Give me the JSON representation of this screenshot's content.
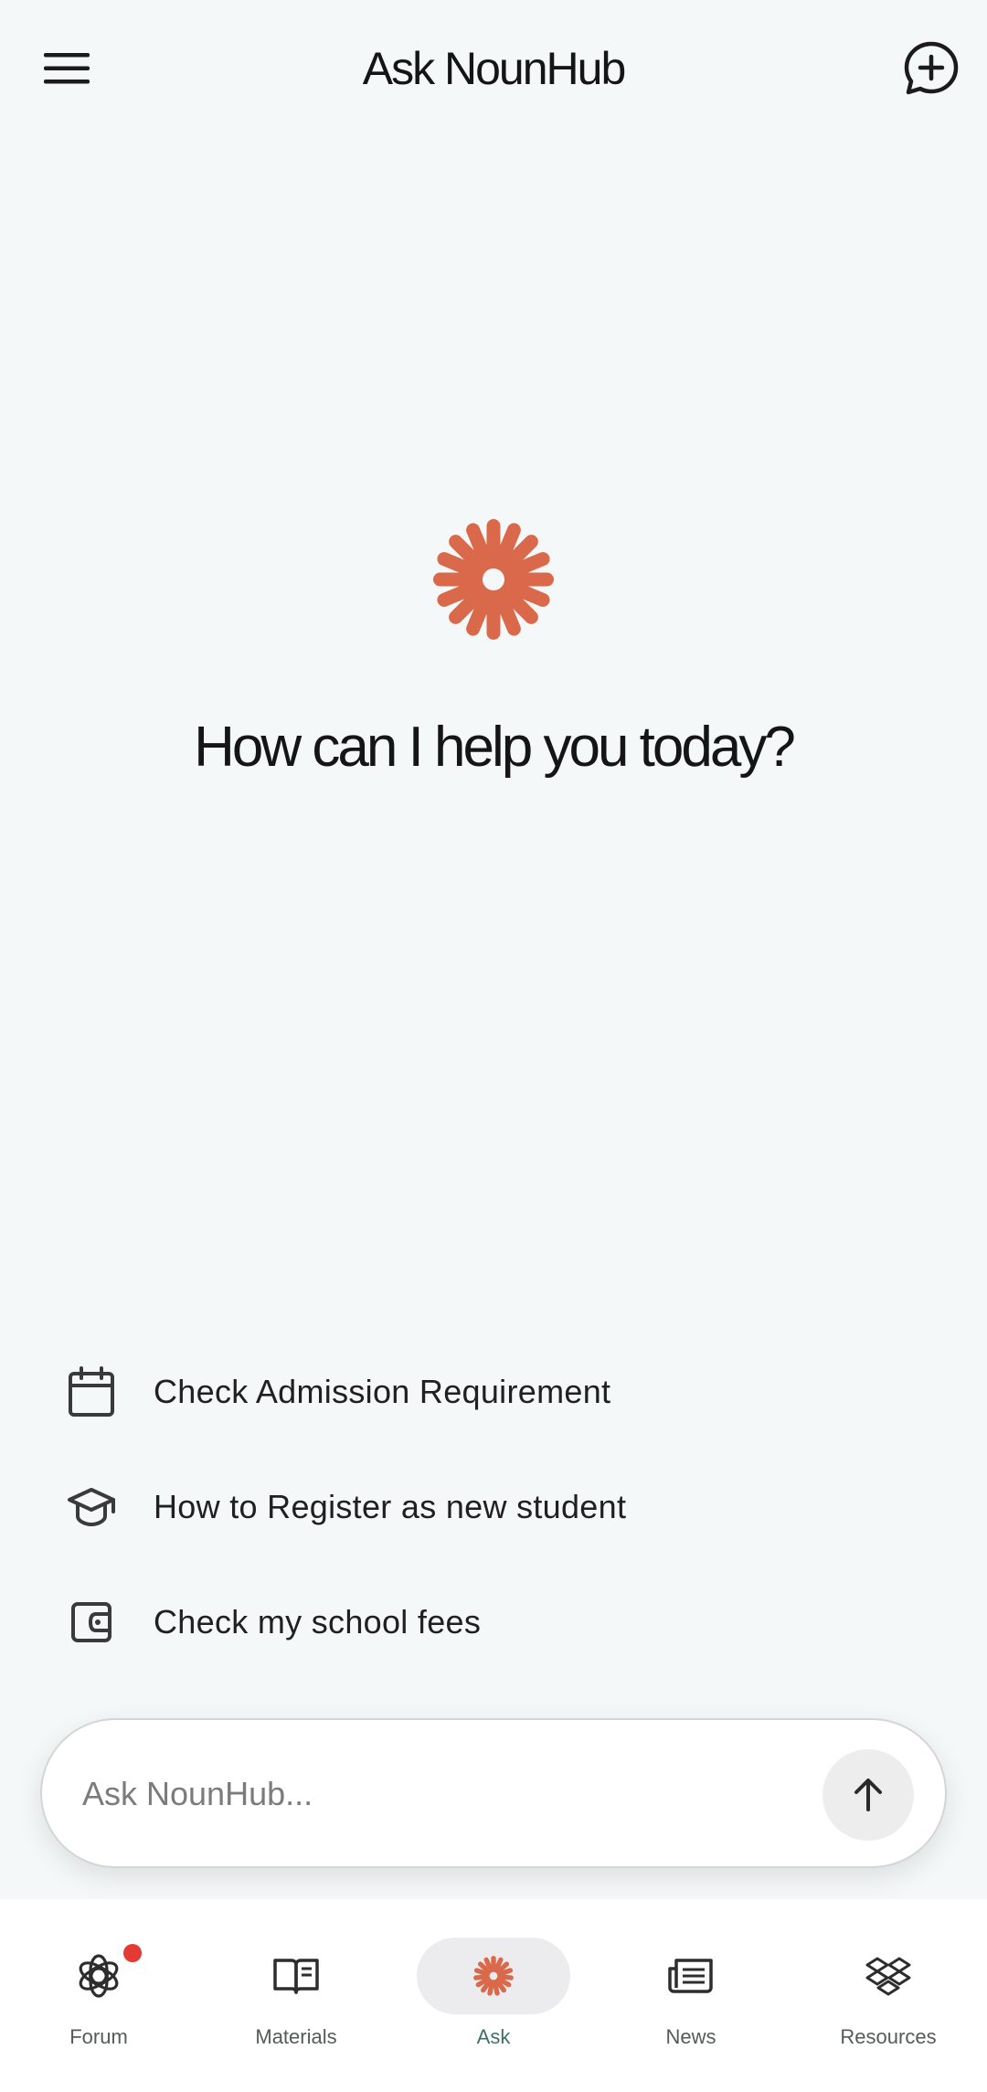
{
  "header": {
    "title": "Ask NounHub",
    "menu_icon": "hamburger-menu-icon",
    "new_chat_icon": "chat-plus-icon"
  },
  "hero": {
    "logo_icon": "sunburst-logo-icon",
    "heading": "How can I help you today?"
  },
  "suggestions": [
    {
      "label": "Check Admission Requirement",
      "icon": "calendar-icon"
    },
    {
      "label": "How to Register as new student",
      "icon": "graduation-cap-icon"
    },
    {
      "label": "Check my school fees",
      "icon": "wallet-icon"
    }
  ],
  "input": {
    "placeholder": "Ask NounHub...",
    "value": "",
    "send_icon": "arrow-up-icon"
  },
  "bottom_nav": [
    {
      "label": "Forum",
      "icon": "forum-knot-icon",
      "has_badge": true
    },
    {
      "label": "Materials",
      "icon": "open-book-icon"
    },
    {
      "label": "Ask",
      "icon": "sunburst-icon",
      "active": true
    },
    {
      "label": "News",
      "icon": "newspaper-icon"
    },
    {
      "label": "Resources",
      "icon": "dropbox-icon"
    }
  ],
  "colors": {
    "accent": "#d9694a",
    "background": "#f5f8f8",
    "active_nav_label": "#3f6f66",
    "badge": "#e53935"
  }
}
